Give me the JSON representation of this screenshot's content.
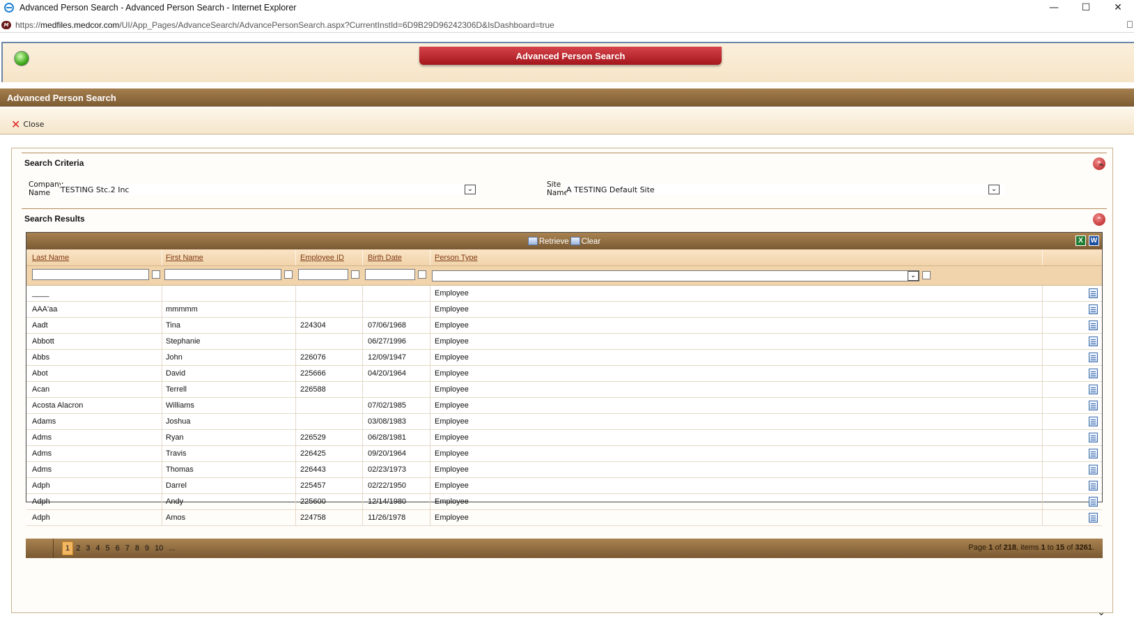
{
  "window": {
    "title": "Advanced Person Search - Advanced Person Search - Internet Explorer",
    "url_prefix": "https://",
    "url_host": "medfiles.medcor.com",
    "url_path": "/UI/App_Pages/AdvanceSearch/AdvancePersonSearch.aspx?CurrentInstId=6D9B29D96242306D&IsDashboard=true"
  },
  "header": {
    "banner": "Advanced Person Search",
    "section_title": "Advanced Person Search",
    "close_label": "Close"
  },
  "criteria": {
    "title": "Search Criteria",
    "company_label_1": "Company",
    "company_label_2": "Name",
    "company_value": "TESTING Stc.2 Inc",
    "site_label_1": "Site",
    "site_label_2": "Name",
    "site_value": "A TESTING Default Site"
  },
  "results": {
    "title": "Search Results",
    "retrieve_label": "Retrieve",
    "clear_label": "Clear",
    "columns": [
      "Last Name",
      "First Name",
      "Employee ID",
      "Birth Date",
      "Person Type"
    ],
    "rows": [
      [
        "____",
        "",
        "",
        "",
        "Employee"
      ],
      [
        "AAA'aa",
        "mmmmm",
        "",
        "",
        "Employee"
      ],
      [
        "Aadt",
        "Tina",
        "224304",
        "07/06/1968",
        "Employee"
      ],
      [
        "Abbott",
        "Stephanie",
        "",
        "06/27/1996",
        "Employee"
      ],
      [
        "Abbs",
        "John",
        "226076",
        "12/09/1947",
        "Employee"
      ],
      [
        "Abot",
        "David",
        "225666",
        "04/20/1964",
        "Employee"
      ],
      [
        "Acan",
        "Terrell",
        "226588",
        "",
        "Employee"
      ],
      [
        "Acosta Alacron",
        "Williams",
        "",
        "07/02/1985",
        "Employee"
      ],
      [
        "Adams",
        "Joshua",
        "",
        "03/08/1983",
        "Employee"
      ],
      [
        "Adms",
        "Ryan",
        "226529",
        "06/28/1981",
        "Employee"
      ],
      [
        "Adms",
        "Travis",
        "226425",
        "09/20/1964",
        "Employee"
      ],
      [
        "Adms",
        "Thomas",
        "226443",
        "02/23/1973",
        "Employee"
      ],
      [
        "Adph",
        "Darrel",
        "225457",
        "02/22/1950",
        "Employee"
      ],
      [
        "Adph",
        "Andy",
        "225600",
        "12/14/1980",
        "Employee"
      ],
      [
        "Adph",
        "Amos",
        "224758",
        "11/26/1978",
        "Employee"
      ]
    ]
  },
  "pager": {
    "pages": [
      "1",
      "2",
      "3",
      "4",
      "5",
      "6",
      "7",
      "8",
      "9",
      "10",
      "..."
    ],
    "current": "1",
    "info_page_label": "Page",
    "info_page": "1",
    "info_of": "of",
    "info_total_pages": "218",
    "info_items_label": ", items",
    "info_from": "1",
    "info_to_label": "to",
    "info_to": "15",
    "info_of2": "of",
    "info_total_items": "3261",
    "info_end": "."
  }
}
